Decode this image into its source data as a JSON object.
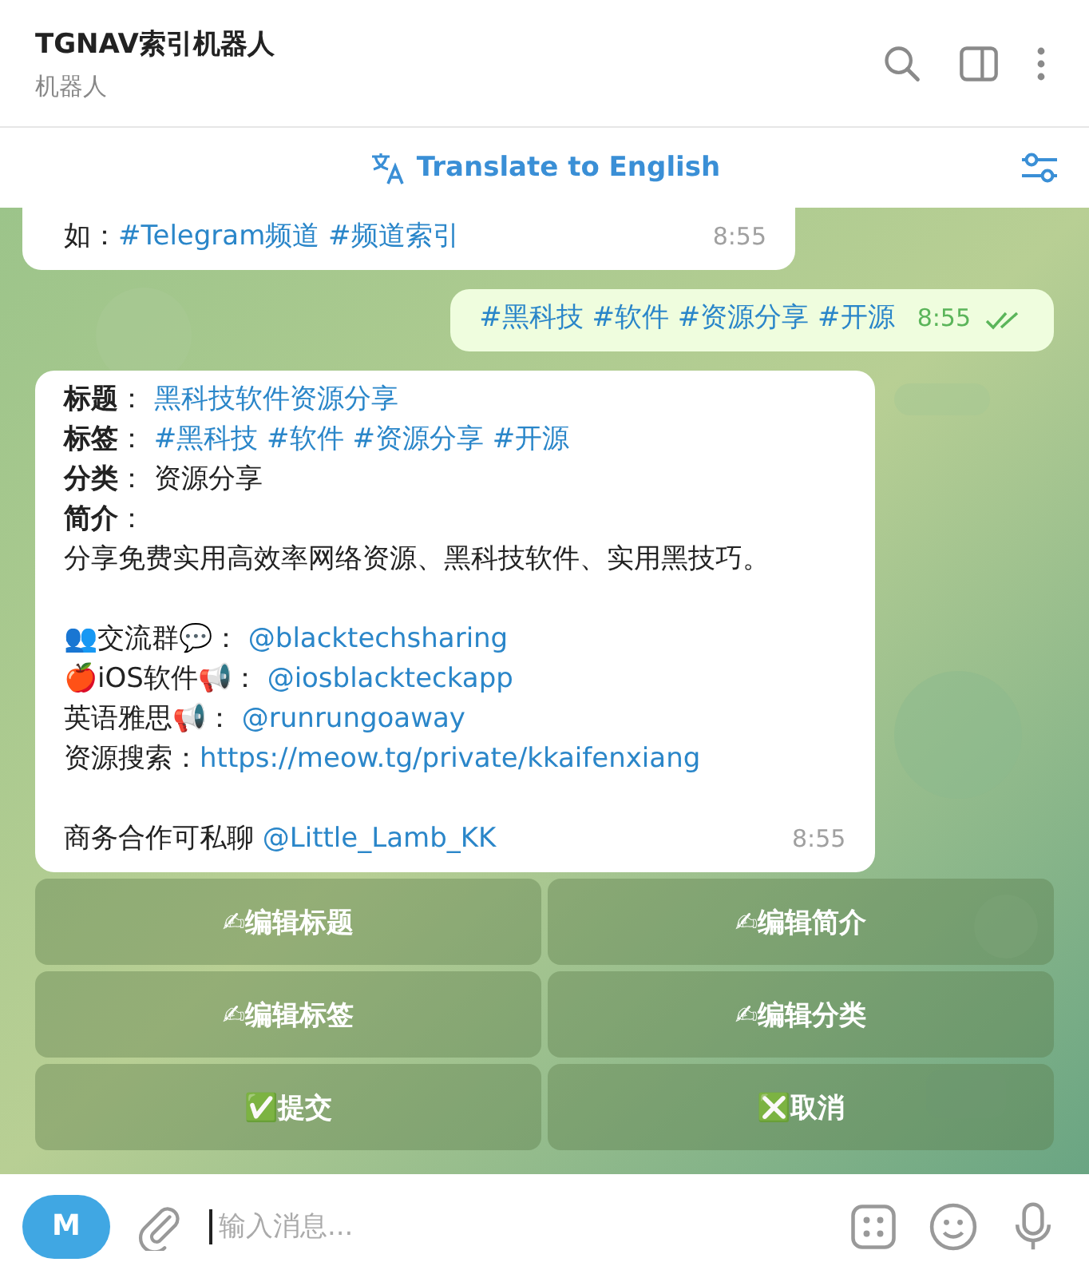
{
  "header": {
    "title": "TGNAV索引机器人",
    "subtitle": "机器人"
  },
  "translate_bar": {
    "label": "Translate to English"
  },
  "messages": [
    {
      "kind": "incoming",
      "paragraphs": [
        {
          "lines": [
            [
              {
                "kind": "plain",
                "text": "如："
              },
              {
                "kind": "link",
                "text": "#Telegram频道 #频道索引"
              }
            ]
          ]
        }
      ],
      "time": "8:55"
    },
    {
      "kind": "outgoing",
      "paragraphs": [
        {
          "lines": [
            [
              {
                "kind": "link",
                "text": "#黑科技 #软件 #资源分享 #开源"
              }
            ]
          ]
        }
      ],
      "time": "8:55",
      "read": true
    },
    {
      "kind": "incoming",
      "paragraphs": [
        {
          "lines": [
            [
              {
                "kind": "bold",
                "text": "标题"
              },
              {
                "kind": "plain",
                "text": "：  "
              },
              {
                "kind": "link",
                "text": "黑科技软件资源分享"
              }
            ],
            [
              {
                "kind": "bold",
                "text": "标签"
              },
              {
                "kind": "plain",
                "text": "：  "
              },
              {
                "kind": "link",
                "text": "#黑科技 #软件 #资源分享 #开源"
              }
            ],
            [
              {
                "kind": "bold",
                "text": "分类"
              },
              {
                "kind": "plain",
                "text": "：  资源分享"
              }
            ],
            [
              {
                "kind": "bold",
                "text": "简介"
              },
              {
                "kind": "plain",
                "text": "："
              }
            ],
            [
              {
                "kind": "plain",
                "text": "分享免费实用高效率网络资源、黑科技软件、实用黑技巧。"
              }
            ]
          ]
        },
        {
          "lines": [
            [
              {
                "kind": "plain",
                "text": "👥交流群💬：  "
              },
              {
                "kind": "link",
                "text": "@blacktechsharing"
              }
            ],
            [
              {
                "kind": "plain",
                "text": "🍎iOS软件📢：  "
              },
              {
                "kind": "link",
                "text": "@iosblackteckapp"
              }
            ],
            [
              {
                "kind": "plain",
                "text": "英语雅思📢：  "
              },
              {
                "kind": "link",
                "text": "@runrungoaway"
              }
            ],
            [
              {
                "kind": "plain",
                "text": "资源搜索："
              },
              {
                "kind": "link",
                "text": "https://meow.tg/private/kkaifenxiang"
              }
            ]
          ]
        },
        {
          "lines": [
            [
              {
                "kind": "plain",
                "text": "商务合作可私聊 "
              },
              {
                "kind": "link",
                "text": "@Little_Lamb_KK"
              }
            ]
          ]
        }
      ],
      "time": "8:55"
    }
  ],
  "keyboard": [
    [
      "✍编辑标题",
      "✍编辑简介"
    ],
    [
      "✍编辑标签",
      "✍编辑分类"
    ],
    [
      "✅提交",
      "❎取消"
    ]
  ],
  "composer": {
    "avatar": "M",
    "placeholder": "输入消息..."
  }
}
